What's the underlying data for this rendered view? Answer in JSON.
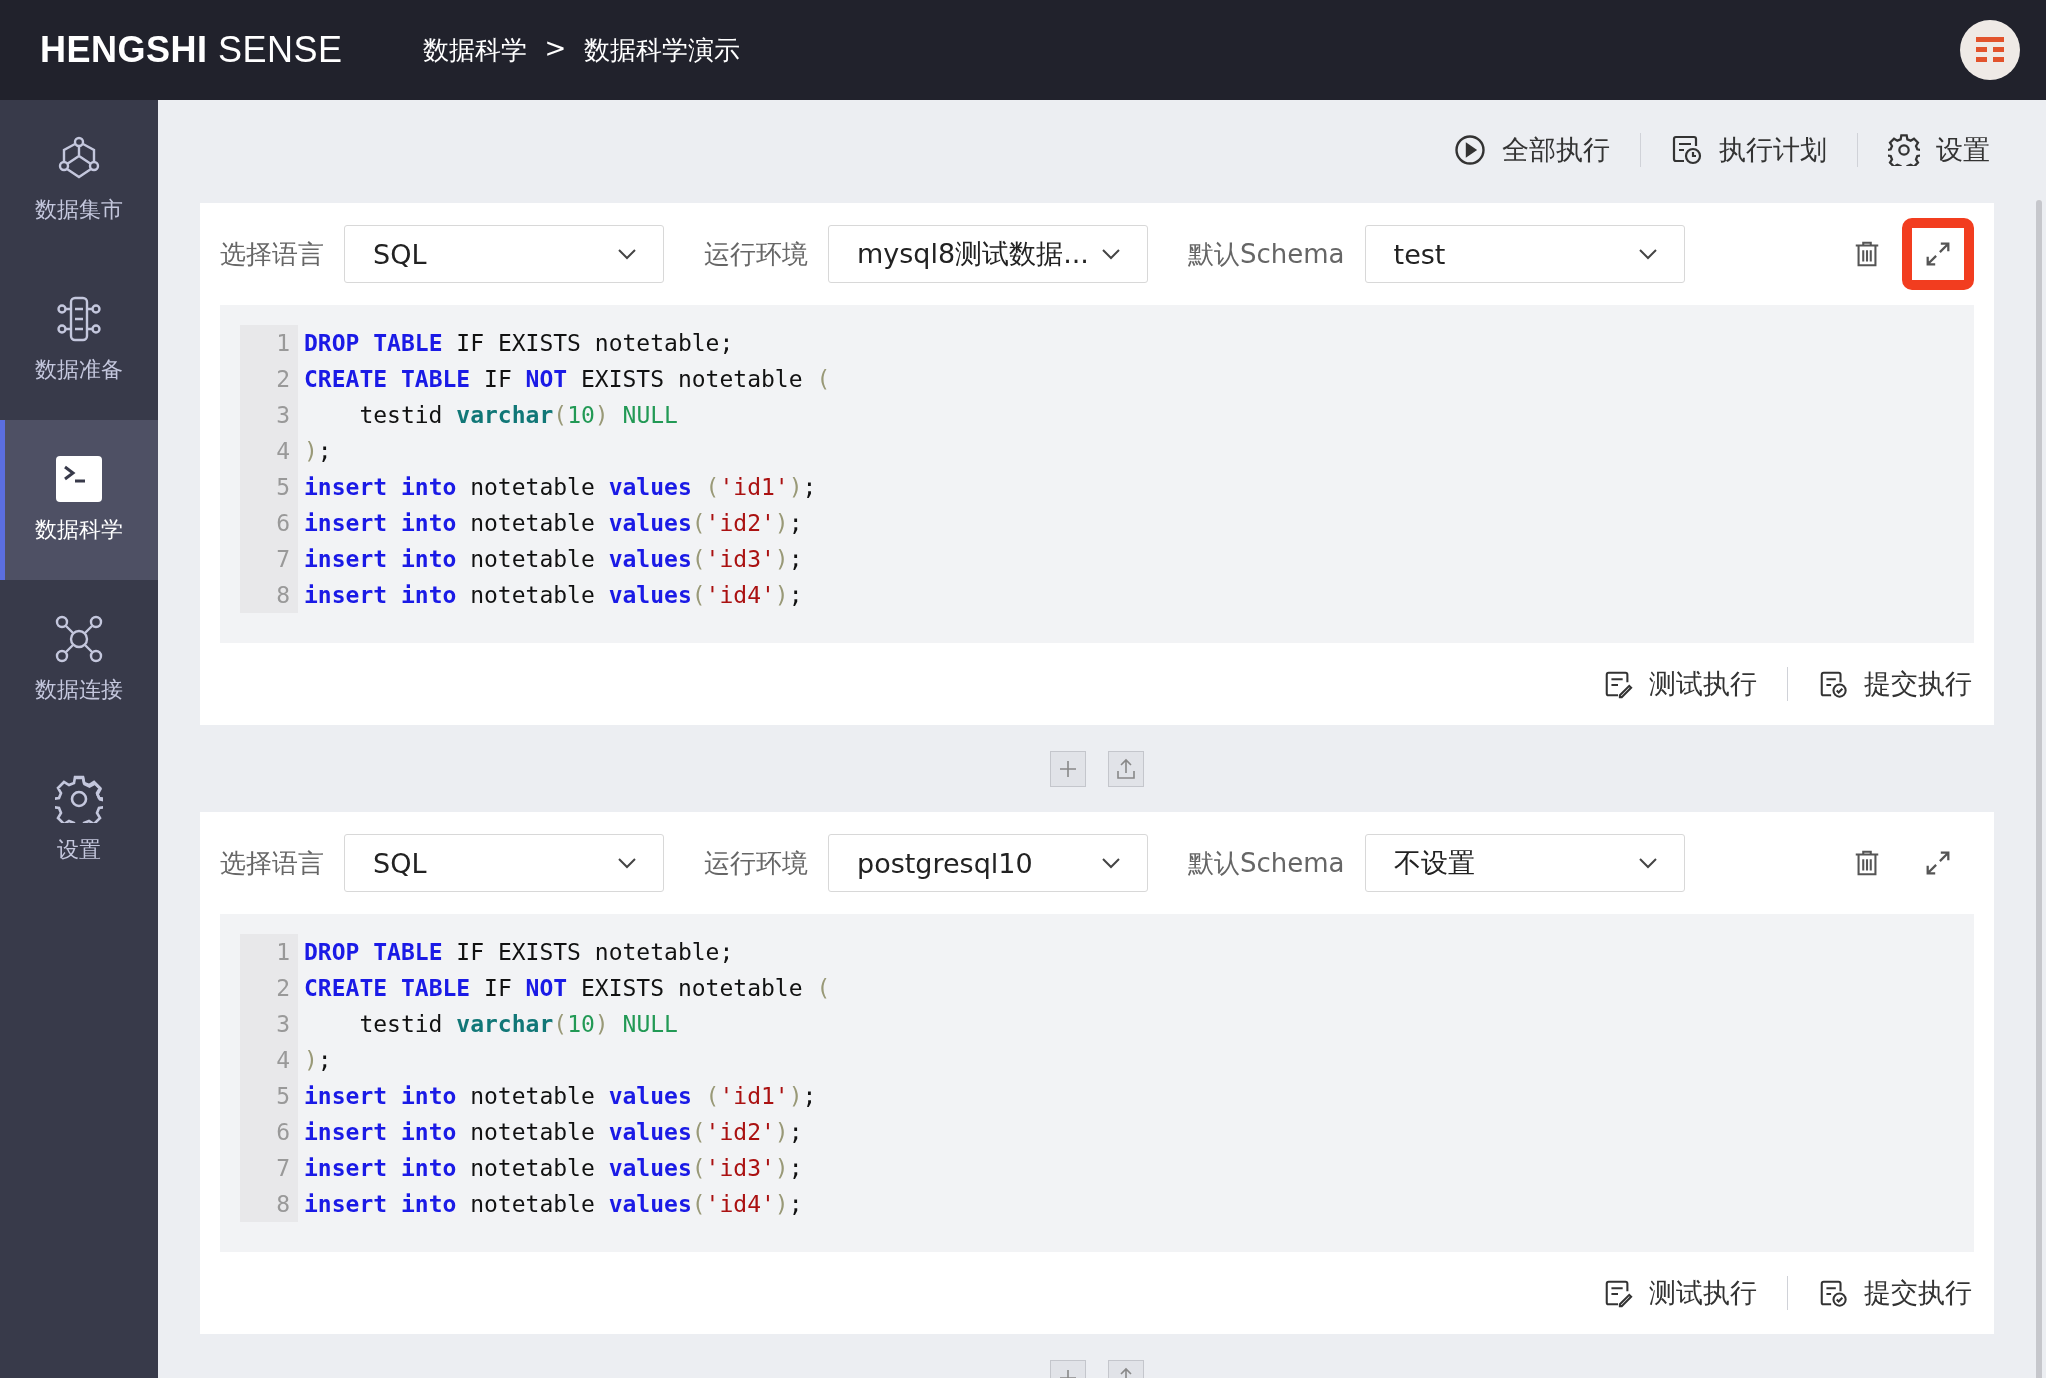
{
  "topbar": {
    "brand_bold": "HENGSHI",
    "brand_light": "SENSE",
    "breadcrumb": {
      "items": [
        "数据科学",
        "数据科学演示"
      ],
      "separator": ">"
    }
  },
  "sidebar": {
    "items": [
      {
        "label": "数据集市",
        "kind": "market",
        "selected": false
      },
      {
        "label": "数据准备",
        "kind": "prep",
        "selected": false
      },
      {
        "label": "数据科学",
        "kind": "terminal",
        "selected": true
      },
      {
        "label": "数据连接",
        "kind": "connect",
        "selected": false
      },
      {
        "label": "设置",
        "kind": "gear",
        "selected": false
      }
    ]
  },
  "toolbar": [
    {
      "label": "全部执行",
      "kind": "play"
    },
    {
      "label": "执行计划",
      "kind": "schedule"
    },
    {
      "label": "设置",
      "kind": "gear"
    }
  ],
  "cells": [
    {
      "language_label": "选择语言",
      "language": "SQL",
      "env_label": "运行环境",
      "env": "mysql8测试数据...",
      "schema_label": "默认Schema",
      "schema": "test",
      "expand_highlighted": true,
      "code": [
        [
          {
            "kind": "keyword",
            "t": "DROP "
          },
          {
            "kind": "keyword",
            "t": "TABLE"
          },
          {
            "kind": "plain",
            "t": " IF EXISTS notetable;"
          }
        ],
        [
          {
            "kind": "keyword",
            "t": "CREATE "
          },
          {
            "kind": "keyword",
            "t": "TABLE"
          },
          {
            "kind": "plain",
            "t": " IF "
          },
          {
            "kind": "keyword",
            "t": "NOT"
          },
          {
            "kind": "plain",
            "t": " EXISTS notetable "
          },
          {
            "kind": "bracket",
            "t": "("
          }
        ],
        [
          {
            "kind": "plain",
            "t": "    testid "
          },
          {
            "kind": "type",
            "t": "varchar"
          },
          {
            "kind": "bracket",
            "t": "("
          },
          {
            "kind": "number",
            "t": "10"
          },
          {
            "kind": "bracket",
            "t": ") "
          },
          {
            "kind": "number",
            "t": "NULL"
          }
        ],
        [
          {
            "kind": "bracket",
            "t": ")"
          },
          {
            "kind": "plain",
            "t": ";"
          }
        ],
        [
          {
            "kind": "keyword",
            "t": "insert "
          },
          {
            "kind": "keyword",
            "t": "into"
          },
          {
            "kind": "plain",
            "t": " notetable "
          },
          {
            "kind": "keyword",
            "t": "values"
          },
          {
            "kind": "bracket",
            "t": " ("
          },
          {
            "kind": "string",
            "t": "'id1'"
          },
          {
            "kind": "bracket",
            "t": ")"
          },
          {
            "kind": "plain",
            "t": ";"
          }
        ],
        [
          {
            "kind": "keyword",
            "t": "insert "
          },
          {
            "kind": "keyword",
            "t": "into"
          },
          {
            "kind": "plain",
            "t": " notetable "
          },
          {
            "kind": "keyword",
            "t": "values"
          },
          {
            "kind": "bracket",
            "t": "("
          },
          {
            "kind": "string",
            "t": "'id2'"
          },
          {
            "kind": "bracket",
            "t": ")"
          },
          {
            "kind": "plain",
            "t": ";"
          }
        ],
        [
          {
            "kind": "keyword",
            "t": "insert "
          },
          {
            "kind": "keyword",
            "t": "into"
          },
          {
            "kind": "plain",
            "t": " notetable "
          },
          {
            "kind": "keyword",
            "t": "values"
          },
          {
            "kind": "bracket",
            "t": "("
          },
          {
            "kind": "string",
            "t": "'id3'"
          },
          {
            "kind": "bracket",
            "t": ")"
          },
          {
            "kind": "plain",
            "t": ";"
          }
        ],
        [
          {
            "kind": "keyword",
            "t": "insert "
          },
          {
            "kind": "keyword",
            "t": "into"
          },
          {
            "kind": "plain",
            "t": " notetable "
          },
          {
            "kind": "keyword",
            "t": "values"
          },
          {
            "kind": "bracket",
            "t": "("
          },
          {
            "kind": "string",
            "t": "'id4'"
          },
          {
            "kind": "bracket",
            "t": ")"
          },
          {
            "kind": "plain",
            "t": ";"
          }
        ]
      ],
      "line_numbers": [
        "1",
        "2",
        "3",
        "4",
        "5",
        "6",
        "7",
        "8"
      ],
      "actions": [
        {
          "label": "测试执行",
          "kind": "test"
        },
        {
          "label": "提交执行",
          "kind": "submit"
        }
      ]
    },
    {
      "language_label": "选择语言",
      "language": "SQL",
      "env_label": "运行环境",
      "env": "postgresql10",
      "schema_label": "默认Schema",
      "schema": "不设置",
      "expand_highlighted": false,
      "code": [
        [
          {
            "kind": "keyword",
            "t": "DROP "
          },
          {
            "kind": "keyword",
            "t": "TABLE"
          },
          {
            "kind": "plain",
            "t": " IF EXISTS notetable;"
          }
        ],
        [
          {
            "kind": "keyword",
            "t": "CREATE "
          },
          {
            "kind": "keyword",
            "t": "TABLE"
          },
          {
            "kind": "plain",
            "t": " IF "
          },
          {
            "kind": "keyword",
            "t": "NOT"
          },
          {
            "kind": "plain",
            "t": " EXISTS notetable "
          },
          {
            "kind": "bracket",
            "t": "("
          }
        ],
        [
          {
            "kind": "plain",
            "t": "    testid "
          },
          {
            "kind": "type",
            "t": "varchar"
          },
          {
            "kind": "bracket",
            "t": "("
          },
          {
            "kind": "number",
            "t": "10"
          },
          {
            "kind": "bracket",
            "t": ") "
          },
          {
            "kind": "number",
            "t": "NULL"
          }
        ],
        [
          {
            "kind": "bracket",
            "t": ")"
          },
          {
            "kind": "plain",
            "t": ";"
          }
        ],
        [
          {
            "kind": "keyword",
            "t": "insert "
          },
          {
            "kind": "keyword",
            "t": "into"
          },
          {
            "kind": "plain",
            "t": " notetable "
          },
          {
            "kind": "keyword",
            "t": "values"
          },
          {
            "kind": "bracket",
            "t": " ("
          },
          {
            "kind": "string",
            "t": "'id1'"
          },
          {
            "kind": "bracket",
            "t": ")"
          },
          {
            "kind": "plain",
            "t": ";"
          }
        ],
        [
          {
            "kind": "keyword",
            "t": "insert "
          },
          {
            "kind": "keyword",
            "t": "into"
          },
          {
            "kind": "plain",
            "t": " notetable "
          },
          {
            "kind": "keyword",
            "t": "values"
          },
          {
            "kind": "bracket",
            "t": "("
          },
          {
            "kind": "string",
            "t": "'id2'"
          },
          {
            "kind": "bracket",
            "t": ")"
          },
          {
            "kind": "plain",
            "t": ";"
          }
        ],
        [
          {
            "kind": "keyword",
            "t": "insert "
          },
          {
            "kind": "keyword",
            "t": "into"
          },
          {
            "kind": "plain",
            "t": " notetable "
          },
          {
            "kind": "keyword",
            "t": "values"
          },
          {
            "kind": "bracket",
            "t": "("
          },
          {
            "kind": "string",
            "t": "'id3'"
          },
          {
            "kind": "bracket",
            "t": ")"
          },
          {
            "kind": "plain",
            "t": ";"
          }
        ],
        [
          {
            "kind": "keyword",
            "t": "insert "
          },
          {
            "kind": "keyword",
            "t": "into"
          },
          {
            "kind": "plain",
            "t": " notetable "
          },
          {
            "kind": "keyword",
            "t": "values"
          },
          {
            "kind": "bracket",
            "t": "("
          },
          {
            "kind": "string",
            "t": "'id4'"
          },
          {
            "kind": "bracket",
            "t": ")"
          },
          {
            "kind": "plain",
            "t": ";"
          }
        ]
      ],
      "line_numbers": [
        "1",
        "2",
        "3",
        "4",
        "5",
        "6",
        "7",
        "8"
      ],
      "actions": [
        {
          "label": "测试执行",
          "kind": "test"
        },
        {
          "label": "提交执行",
          "kind": "submit"
        }
      ]
    }
  ]
}
